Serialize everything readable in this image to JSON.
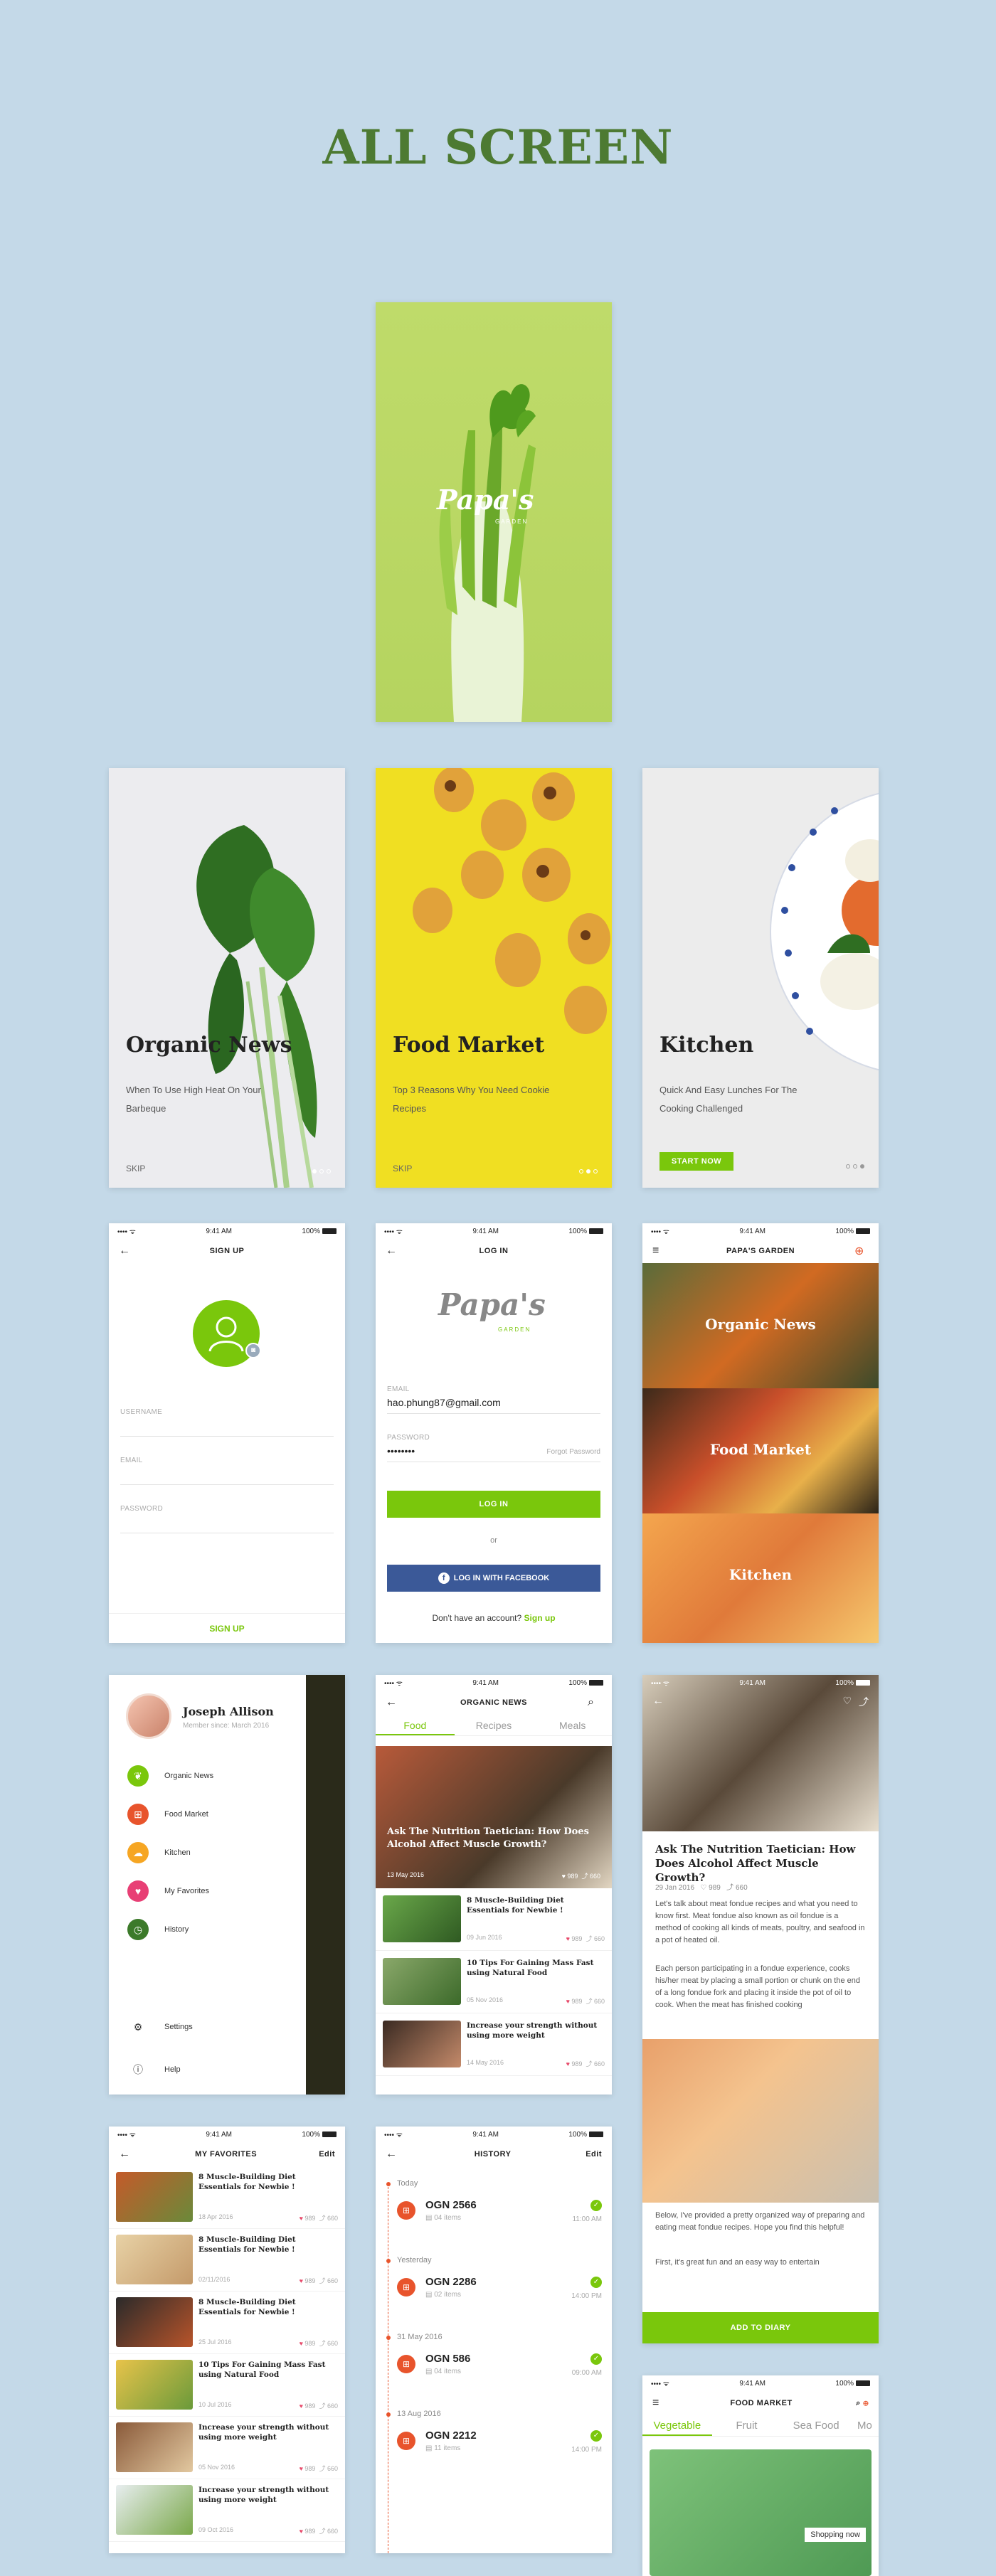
{
  "page_title": "ALL SCREEN",
  "splash": {
    "logo": "Papa's",
    "logo_sub": "GARDEN"
  },
  "onboarding": [
    {
      "title": "Organic News",
      "subtitle": "When To Use High Heat On Your Barbeque",
      "skip": "SKIP"
    },
    {
      "title": "Food Market",
      "subtitle": "Top 3 Reasons Why You Need Cookie Recipes",
      "skip": "SKIP"
    },
    {
      "title": "Kitchen",
      "subtitle": "Quick And Easy Lunches For The Cooking Challenged",
      "cta": "START NOW"
    }
  ],
  "status": {
    "time": "9:41 AM",
    "battery": "100%"
  },
  "signup": {
    "title": "SIGN UP",
    "username": "USERNAME",
    "email": "EMAIL",
    "password": "PASSWORD",
    "button": "SIGN UP"
  },
  "login": {
    "title": "LOG IN",
    "logo": "Papa's",
    "logo_sub": "GARDEN",
    "email_label": "EMAIL",
    "email_value": "hao.phung87@gmail.com",
    "password_label": "PASSWORD",
    "password_value": "••••••••",
    "forgot": "Forgot Password",
    "login_button": "LOG IN",
    "or": "or",
    "fb_button": "LOG IN WITH FACEBOOK",
    "signup_prompt": "Don't have an account?",
    "signup_link": "Sign up"
  },
  "home": {
    "title": "PAPA'S GARDEN",
    "cards": [
      "Organic News",
      "Food Market",
      "Kitchen"
    ]
  },
  "drawer": {
    "name": "Joseph Allison",
    "member": "Member since: March 2016",
    "items": [
      "Organic News",
      "Food Market",
      "Kitchen",
      "My Favorites",
      "History"
    ],
    "settings": "Settings",
    "help": "Help"
  },
  "organic_news": {
    "title": "ORGANIC NEWS",
    "tabs": [
      "Food",
      "Recipes",
      "Meals"
    ],
    "hero_title": "Ask The Nutrition Taetician: How Does Alcohol Affect Muscle Growth?",
    "hero_date": "13 May 2016",
    "hero_likes": "989",
    "hero_shares": "660",
    "rows": [
      {
        "title": "8 Muscle-Building Diet Essentials for Newbie !",
        "date": "09 Jun 2016",
        "likes": "989",
        "shares": "660"
      },
      {
        "title": "10 Tips For Gaining Mass Fast using Natural Food",
        "date": "05 Nov 2016",
        "likes": "989",
        "shares": "660"
      },
      {
        "title": "Increase your strength without using more weight",
        "date": "14 May 2016",
        "likes": "989",
        "shares": "660"
      }
    ]
  },
  "article": {
    "title": "Ask The Nutrition Taetician: How Does Alcohol Affect Muscle Growth?",
    "date": "29 Jan 2016",
    "likes": "989",
    "shares": "660",
    "p1": "Let's talk about meat fondue recipes and what you need to know first. Meat fondue also known as oil fondue is a method of cooking all kinds of meats, poultry, and seafood in a pot of heated oil.",
    "p2": "Each person participating in a fondue experience, cooks his/her meat by placing a small portion or chunk on the end of a long fondue fork and placing it inside the pot of oil to cook. When the meat has finished cooking",
    "p3": "Below, I've provided a pretty organized way of preparing and eating meat fondue recipes. Hope you find this helpful!",
    "p4": "First, it's great fun and an easy way to entertain",
    "button": "ADD TO DIARY"
  },
  "favorites": {
    "title": "MY FAVORITES",
    "edit": "Edit",
    "rows": [
      {
        "title": "8 Muscle-Building Diet Essentials for Newbie !",
        "date": "18 Apr 2016",
        "likes": "989",
        "shares": "660"
      },
      {
        "title": "8 Muscle-Building Diet Essentials for Newbie !",
        "date": "02/11/2016",
        "likes": "989",
        "shares": "660"
      },
      {
        "title": "8 Muscle-Building Diet Essentials for Newbie !",
        "date": "25 Jul 2016",
        "likes": "989",
        "shares": "660"
      },
      {
        "title": "10 Tips For Gaining Mass Fast using Natural Food",
        "date": "10 Jul 2016",
        "likes": "989",
        "shares": "660"
      },
      {
        "title": "Increase your strength without using more weight",
        "date": "05 Nov 2016",
        "likes": "989",
        "shares": "660"
      },
      {
        "title": "Increase your strength without using more weight",
        "date": "09 Oct 2016",
        "likes": "989",
        "shares": "660"
      }
    ]
  },
  "history": {
    "title": "HISTORY",
    "edit": "Edit",
    "groups": [
      {
        "label": "Today",
        "code": "OGN 2566",
        "items": "04 items",
        "time": "11:00 AM"
      },
      {
        "label": "Yesterday",
        "code": "OGN 2286",
        "items": "02 items",
        "time": "14:00 PM"
      },
      {
        "label": "31 May 2016",
        "code": "OGN 586",
        "items": "04 items",
        "time": "09:00 AM"
      },
      {
        "label": "13 Aug 2016",
        "code": "OGN 2212",
        "items": "11 items",
        "time": "14:00 PM"
      }
    ]
  },
  "food_market": {
    "title": "FOOD MARKET",
    "tabs": [
      "Vegetable",
      "Fruit",
      "Sea Food",
      "Mo"
    ],
    "tag": "Shopping now"
  },
  "colors": {
    "accent": "#7ac70c",
    "heading": "#4d7a32",
    "background": "#c4d9e8",
    "facebook": "#3b5998",
    "history_accent": "#e8542c"
  }
}
